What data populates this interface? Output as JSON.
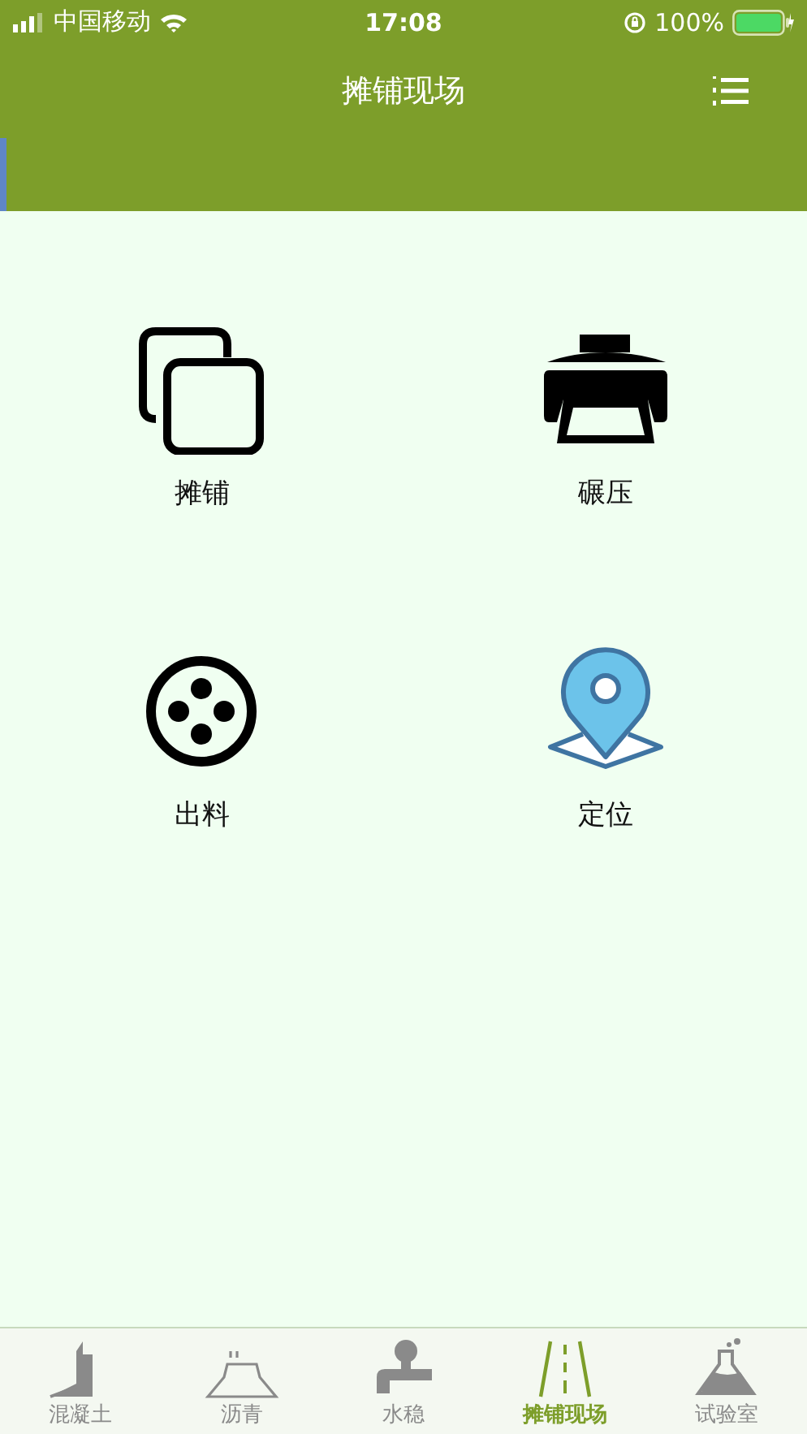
{
  "status_bar": {
    "carrier": "中国移动",
    "time": "17:08",
    "battery": "100%"
  },
  "header": {
    "title": "摊铺现场"
  },
  "menu_items": [
    {
      "label": "摊铺"
    },
    {
      "label": "碾压"
    },
    {
      "label": "出料"
    },
    {
      "label": "定位"
    }
  ],
  "tabs": [
    {
      "label": "混凝土",
      "selected": false
    },
    {
      "label": "沥青",
      "selected": false
    },
    {
      "label": "水稳",
      "selected": false
    },
    {
      "label": "摊铺现场",
      "selected": true
    },
    {
      "label": "试验室",
      "selected": false
    }
  ]
}
